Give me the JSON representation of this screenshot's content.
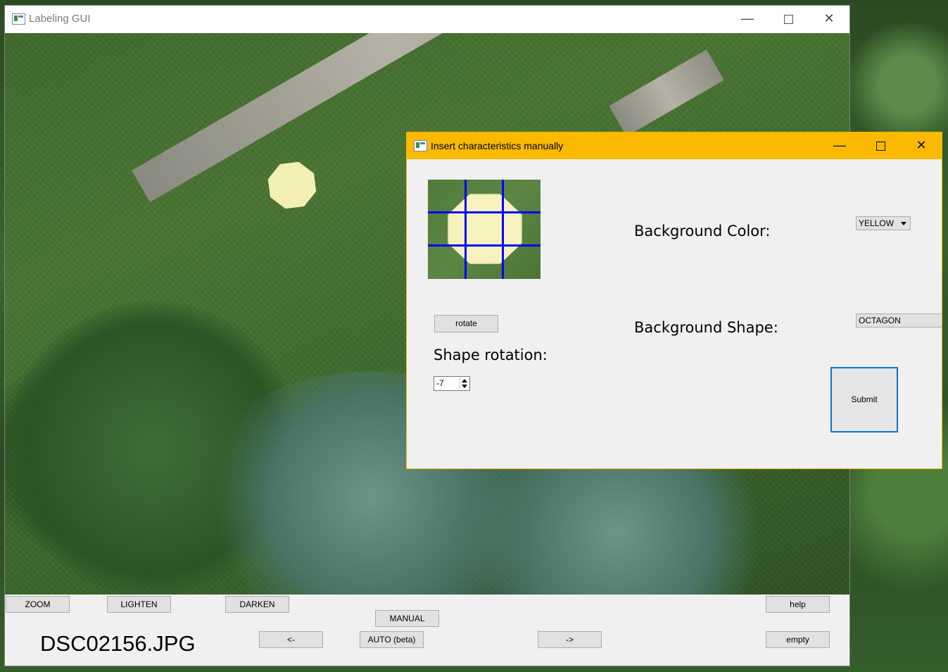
{
  "main_window": {
    "title": "Labeling GUI",
    "controls": {
      "zoom": "ZOOM",
      "lighten": "LIGHTEN",
      "darken": "DARKEN",
      "manual": "MANUAL",
      "auto": "AUTO (beta)",
      "prev": "<-",
      "next": "->",
      "help": "help",
      "empty": "empty",
      "filename": "DSC02156.JPG"
    }
  },
  "dialog": {
    "title": "Insert characteristics manually",
    "rotate_label": "rotate",
    "shape_rotation_label": "Shape rotation:",
    "shape_rotation_value": "-7",
    "background_color_label": "Background Color:",
    "background_color_value": "YELLOW",
    "background_shape_label": "Background Shape:",
    "background_shape_value": "OCTAGON",
    "submit_label": "Submit"
  },
  "window_controls": {
    "minimize_glyph": "—",
    "close_glyph": "✕"
  },
  "icons": [
    "app-icon",
    "minimize-icon",
    "maximize-icon",
    "close-icon",
    "dropdown-arrow-icon",
    "spin-up-icon",
    "spin-down-icon"
  ]
}
